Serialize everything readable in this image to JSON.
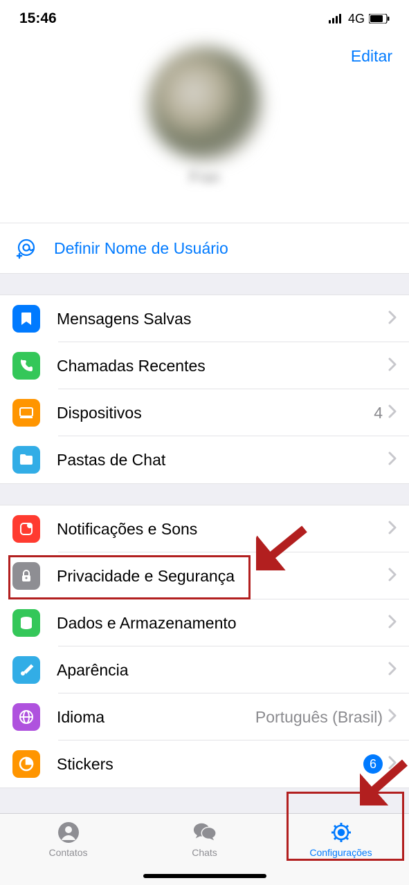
{
  "status": {
    "time": "15:46",
    "network": "4G"
  },
  "header": {
    "edit": "Editar",
    "name": "Fran",
    "sub": " "
  },
  "username": {
    "label": "Definir Nome de Usuário"
  },
  "group1": [
    {
      "icon": "bookmark",
      "color": "#007aff",
      "label": "Mensagens Salvas"
    },
    {
      "icon": "phone",
      "color": "#34c759",
      "label": "Chamadas Recentes"
    },
    {
      "icon": "devices",
      "color": "#ff9500",
      "label": "Dispositivos",
      "value": "4"
    },
    {
      "icon": "folder",
      "color": "#32ade6",
      "label": "Pastas de Chat"
    }
  ],
  "group2": [
    {
      "icon": "notifications",
      "color": "#ff3b30",
      "label": "Notificações e Sons"
    },
    {
      "icon": "lock",
      "color": "#8e8e93",
      "label": "Privacidade e Segurança"
    },
    {
      "icon": "data",
      "color": "#34c759",
      "label": "Dados e Armazenamento"
    },
    {
      "icon": "appearance",
      "color": "#32ade6",
      "label": "Aparência"
    },
    {
      "icon": "language",
      "color": "#af52de",
      "label": "Idioma",
      "value": "Português (Brasil)"
    },
    {
      "icon": "stickers",
      "color": "#ff9500",
      "label": "Stickers",
      "badge": "6"
    }
  ],
  "tabs": {
    "contacts": "Contatos",
    "chats": "Chats",
    "settings": "Configurações"
  }
}
